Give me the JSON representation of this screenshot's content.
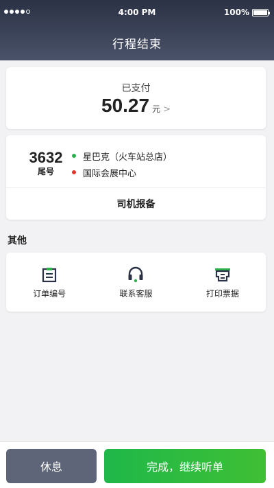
{
  "status_bar": {
    "time": "4:00 PM",
    "battery": "100%"
  },
  "header": {
    "title": "行程结束"
  },
  "payment": {
    "label": "已支付",
    "amount": "50.27",
    "currency": "元"
  },
  "trip": {
    "tail_number": "3632",
    "tail_label": "尾号",
    "origin": "星巴克（火车站总店）",
    "destination": "国际会展中心",
    "origin_color": "#2bb24c",
    "destination_color": "#e0382e",
    "report_label": "司机报备"
  },
  "other": {
    "title": "其他",
    "items": [
      {
        "label": "订单编号",
        "icon": "order-number-icon"
      },
      {
        "label": "联系客服",
        "icon": "headset-icon"
      },
      {
        "label": "打印票据",
        "icon": "printer-icon"
      }
    ]
  },
  "footer": {
    "rest_label": "休息",
    "continue_label": "完成，继续听单"
  }
}
